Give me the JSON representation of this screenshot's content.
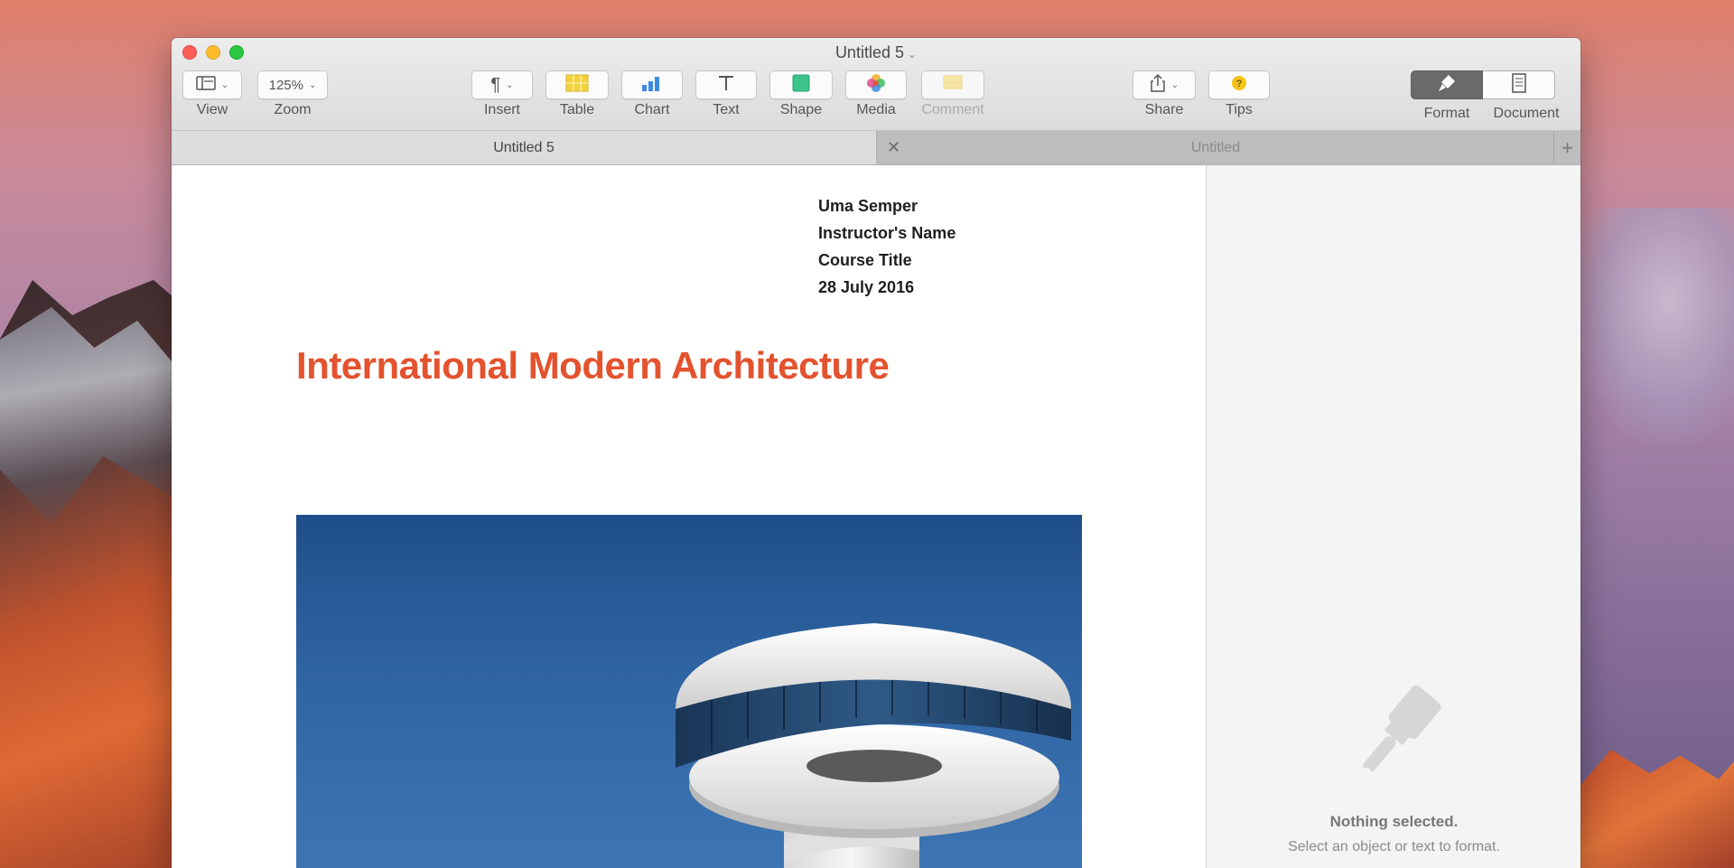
{
  "window": {
    "title": "Untitled 5"
  },
  "toolbar": {
    "view_label": "View",
    "zoom_value": "125%",
    "zoom_label": "Zoom",
    "insert_label": "Insert",
    "table_label": "Table",
    "chart_label": "Chart",
    "text_label": "Text",
    "shape_label": "Shape",
    "media_label": "Media",
    "comment_label": "Comment",
    "share_label": "Share",
    "tips_label": "Tips",
    "format_label": "Format",
    "document_label": "Document"
  },
  "tabs": [
    {
      "label": "Untitled 5",
      "active": true
    },
    {
      "label": "Untitled",
      "active": false
    }
  ],
  "document": {
    "address_lines": [
      "Uma Semper",
      "Instructor's Name",
      "Course Title",
      "28 July 2016"
    ],
    "title": "International Modern Architecture",
    "accent_color": "#e4522e"
  },
  "sidebar": {
    "message_title": "Nothing selected.",
    "message_hint": "Select an object or text to format."
  },
  "icons": [
    "view-icon",
    "pilcrow-icon",
    "table-icon",
    "chart-icon",
    "text-icon",
    "shape-icon",
    "media-icon",
    "comment-icon",
    "share-icon",
    "tips-icon",
    "format-brush-icon",
    "document-icon",
    "paintbrush-icon"
  ]
}
